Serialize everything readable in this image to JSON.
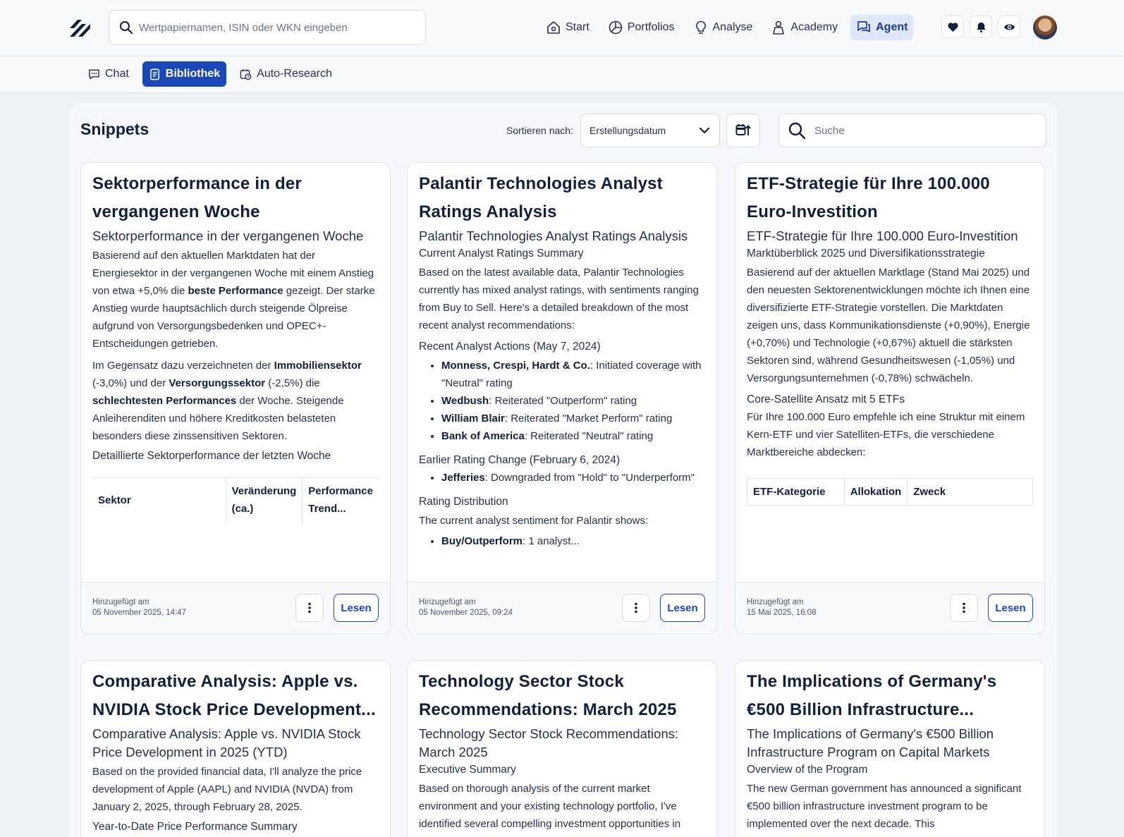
{
  "header": {
    "search_placeholder": "Wertpapiernamen, ISIN oder WKN eingeben",
    "nav": [
      {
        "label": "Start",
        "icon": "home-icon"
      },
      {
        "label": "Portfolios",
        "icon": "pie-chart-icon"
      },
      {
        "label": "Analyse",
        "icon": "lightbulb-icon"
      },
      {
        "label": "Academy",
        "icon": "academy-icon"
      },
      {
        "label": "Agent",
        "icon": "chat-bubbles-icon",
        "active": true
      }
    ],
    "icons": [
      "heart-icon",
      "bell-icon",
      "eye-icon"
    ]
  },
  "subnav": {
    "tabs": [
      {
        "label": "Chat",
        "icon": "chat-icon"
      },
      {
        "label": "Bibliothek",
        "icon": "library-icon",
        "active": true
      },
      {
        "label": "Auto-Research",
        "icon": "calendar-clock-icon"
      }
    ]
  },
  "library": {
    "title": "Snippets",
    "sort_label": "Sortieren nach:",
    "sort_value": "Erstellungsdatum",
    "search_placeholder": "Suche",
    "added_label": "Hinzugefügt am",
    "read_label": "Lesen"
  },
  "cards": [
    {
      "title": "Sektorperformance in der vergangenen Woche",
      "subtitle": "Sektorperformance in der vergangenen Woche",
      "p1a": "Basierend auf den aktuellen Marktdaten hat der Energiesektor in der vergangenen Woche mit einem Anstieg von etwa +5,0% die ",
      "p1b": "beste Performance",
      "p1c": " gezeigt. Der starke Anstieg wurde hauptsächlich durch steigende Ölpreise aufgrund von Versorgungsbedenken und OPEC+-Entscheidungen getrieben.",
      "p2a": "Im Gegensatz dazu verzeichneten der ",
      "p2b": "Immobiliensektor",
      "p2c": " (-3,0%) und der ",
      "p2d": "Versorgungssektor",
      "p2e": " (-2,5%) die ",
      "p2f": "schlechtesten Performances",
      "p2g": " der Woche. Steigende Anleiherenditen und höhere Kreditkosten belasteten besonders diese zinssensitiven Sektoren.",
      "h4": "Detaillierte Sektorperformance der letzten Woche",
      "table": [
        "Sektor",
        "Veränderung (ca.)",
        "Performance Trend..."
      ],
      "date": "05 November 2025, 14:47"
    },
    {
      "title": "Palantir Technologies Analyst Ratings Analysis",
      "subtitle": "Palantir Technologies Analyst Ratings Analysis",
      "h4a": "Current Analyst Ratings Summary",
      "p1": "Based on the latest available data, Palantir Technologies currently has mixed analyst ratings, with sentiments ranging from Buy to Sell. Here's a detailed breakdown of the most recent analyst recommendations:",
      "h4b": "Recent Analyst Actions (May 7, 2024)",
      "list1": [
        {
          "b": "Monness, Crespi, Hardt & Co.",
          "t": ": Initiated coverage with \"Neutral\" rating"
        },
        {
          "b": "Wedbush",
          "t": ": Reiterated \"Outperform\" rating"
        },
        {
          "b": "William Blair",
          "t": ": Reiterated \"Market Perform\" rating"
        },
        {
          "b": "Bank of America",
          "t": ": Reiterated \"Neutral\" rating"
        }
      ],
      "h4c": "Earlier Rating Change (February 6, 2024)",
      "list2": [
        {
          "b": "Jefferies",
          "t": ": Downgraded from \"Hold\" to \"Underperform\""
        }
      ],
      "h4d": "Rating Distribution",
      "p2": "The current analyst sentiment for Palantir shows:",
      "list3": [
        {
          "b": "Buy/Outperform",
          "t": ": 1 analyst..."
        }
      ],
      "date": "05 November 2025, 09:24"
    },
    {
      "title": "ETF-Strategie für Ihre 100.000 Euro-Investition",
      "subtitle": "ETF-Strategie für Ihre 100.000 Euro-Investition",
      "h4a": "Marktüberblick 2025 und Diversifikationsstrategie",
      "p1": "Basierend auf der aktuellen Marktlage (Stand Mai 2025) und den neuesten Sektorenentwicklungen möchte ich Ihnen eine diversifizierte ETF-Strategie vorstellen. Die Marktdaten zeigen uns, dass Kommunikationsdienste (+0,90%), Energie (+0,70%) und Technologie (+0,67%) aktuell die stärksten Sektoren sind, während Gesundheitswesen (-1,05%) und Versorgungsunternehmen (-0,78%) schwächeln.",
      "h4b": "Core-Satellite Ansatz mit 5 ETFs",
      "p2": "Für Ihre 100.000 Euro empfehle ich eine Struktur mit einem Kern-ETF und vier Satelliten-ETFs, die verschiedene Marktbereiche abdecken:",
      "table": [
        "ETF-Kategorie",
        "Allokation",
        "Zweck"
      ],
      "date": "15 Mai 2025, 16:08"
    },
    {
      "title": "Comparative Analysis: Apple vs. NVIDIA Stock Price Development...",
      "subtitle": "Comparative Analysis: Apple vs. NVIDIA Stock Price Development in 2025 (YTD)",
      "p1": "Based on the provided financial data, I'll analyze the price development of Apple (AAPL) and NVIDIA (NVDA) from January 2, 2025, through February 28, 2025.",
      "h4a": "Year-to-Date Price Performance Summary"
    },
    {
      "title": "Technology Sector Stock Recommendations: March 2025",
      "subtitle": "Technology Sector Stock Recommendations: March 2025",
      "h4a": "Executive Summary",
      "p1": "Based on thorough analysis of the current market environment and your existing technology portfolio, I've identified several compelling investment opportunities in"
    },
    {
      "title": "The Implications of Germany's €500 Billion Infrastructure...",
      "subtitle": "The Implications of Germany's €500 Billion Infrastructure Program on Capital Markets",
      "h4a": "Overview of the Program",
      "p1": "The new German government has announced a significant €500 billion infrastructure investment program to be implemented over the next decade. This"
    }
  ]
}
